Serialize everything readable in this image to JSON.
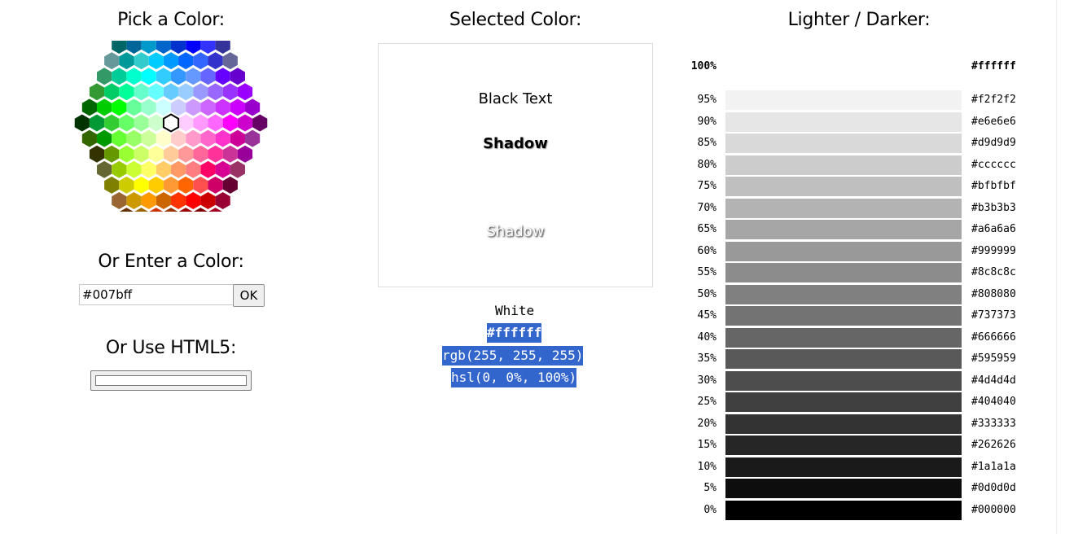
{
  "picker": {
    "title": "Pick a Color:",
    "rows": [
      [
        "#003366",
        "#336699",
        "#3366CC",
        "#003399",
        "#000099",
        "#0000CC",
        "#000066"
      ],
      [
        "#006666",
        "#006699",
        "#0099CC",
        "#0066CC",
        "#0033CC",
        "#0000FF",
        "#3333FF",
        "#333399"
      ],
      [
        "#669999",
        "#009999",
        "#33CCCC",
        "#00CCFF",
        "#0099FF",
        "#0066FF",
        "#3366FF",
        "#3333CC",
        "#666699"
      ],
      [
        "#339966",
        "#00CC99",
        "#00FFCC",
        "#00FFFF",
        "#33CCFF",
        "#3399FF",
        "#6699FF",
        "#6666FF",
        "#6600FF",
        "#6600CC"
      ],
      [
        "#339933",
        "#00CC66",
        "#00FF99",
        "#66FFCC",
        "#66FFFF",
        "#66CCFF",
        "#99CCFF",
        "#9999FF",
        "#9966FF",
        "#9933FF",
        "#9900FF"
      ],
      [
        "#006600",
        "#00CC00",
        "#00FF00",
        "#66FF99",
        "#99FFCC",
        "#CCFFFF",
        "#CCCCFF",
        "#CC99FF",
        "#CC66FF",
        "#CC33FF",
        "#CC00FF",
        "#9900CC"
      ],
      [
        "#003300",
        "#009933",
        "#33CC33",
        "#66FF66",
        "#99FF99",
        "#CCFFCC",
        "#FFFFFF",
        "#FFCCFF",
        "#FF99FF",
        "#FF66FF",
        "#FF00FF",
        "#CC00CC",
        "#660066"
      ],
      [
        "#336600",
        "#009900",
        "#66FF33",
        "#99FF66",
        "#CCFF99",
        "#FFFFCC",
        "#FFCCCC",
        "#FF99CC",
        "#FF66CC",
        "#FF33CC",
        "#CC0099",
        "#993399"
      ],
      [
        "#333300",
        "#669900",
        "#99FF33",
        "#CCFF66",
        "#FFFF99",
        "#FFCC99",
        "#FF9999",
        "#FF6699",
        "#FF3399",
        "#CC3399",
        "#990099"
      ],
      [
        "#666633",
        "#99CC00",
        "#CCFF33",
        "#FFFF66",
        "#FFCC66",
        "#FF9966",
        "#FF7C80",
        "#FF0066",
        "#D60093",
        "#993366"
      ],
      [
        "#808000",
        "#CCCC00",
        "#FFFF00",
        "#FFCC00",
        "#FF9933",
        "#FF6600",
        "#FF5050",
        "#CC0066",
        "#660033"
      ],
      [
        "#996633",
        "#CC9900",
        "#FF9900",
        "#CC6600",
        "#FF3300",
        "#FF0000",
        "#CC0000",
        "#990033"
      ],
      [
        "#663300",
        "#996600",
        "#CC3300",
        "#993300",
        "#990000",
        "#800000",
        "#A50021"
      ]
    ],
    "selected": "#FFFFFF"
  },
  "enter": {
    "title": "Or Enter a Color:",
    "value": "#007bff",
    "ok_label": "OK"
  },
  "html5": {
    "title": "Or Use HTML5:",
    "value": "#ffffff"
  },
  "selected": {
    "title": "Selected Color:",
    "color": "#ffffff",
    "black_text": "Black Text",
    "shadow_dark": "Shadow",
    "white_text": "White Text",
    "shadow_light": "Shadow",
    "name": "White",
    "hex": "#ffffff",
    "rgb": "rgb(255, 255, 255)",
    "hsl": "hsl(0, 0%, 100%)"
  },
  "shades": {
    "title": "Lighter / Darker:",
    "items": [
      {
        "pct": "100%",
        "hex": "#ffffff"
      },
      {
        "pct": "95%",
        "hex": "#f2f2f2"
      },
      {
        "pct": "90%",
        "hex": "#e6e6e6"
      },
      {
        "pct": "85%",
        "hex": "#d9d9d9"
      },
      {
        "pct": "80%",
        "hex": "#cccccc"
      },
      {
        "pct": "75%",
        "hex": "#bfbfbf"
      },
      {
        "pct": "70%",
        "hex": "#b3b3b3"
      },
      {
        "pct": "65%",
        "hex": "#a6a6a6"
      },
      {
        "pct": "60%",
        "hex": "#999999"
      },
      {
        "pct": "55%",
        "hex": "#8c8c8c"
      },
      {
        "pct": "50%",
        "hex": "#808080"
      },
      {
        "pct": "45%",
        "hex": "#737373"
      },
      {
        "pct": "40%",
        "hex": "#666666"
      },
      {
        "pct": "35%",
        "hex": "#595959"
      },
      {
        "pct": "30%",
        "hex": "#4d4d4d"
      },
      {
        "pct": "25%",
        "hex": "#404040"
      },
      {
        "pct": "20%",
        "hex": "#333333"
      },
      {
        "pct": "15%",
        "hex": "#262626"
      },
      {
        "pct": "10%",
        "hex": "#1a1a1a"
      },
      {
        "pct": "5%",
        "hex": "#0d0d0d"
      },
      {
        "pct": "0%",
        "hex": "#000000"
      }
    ]
  }
}
